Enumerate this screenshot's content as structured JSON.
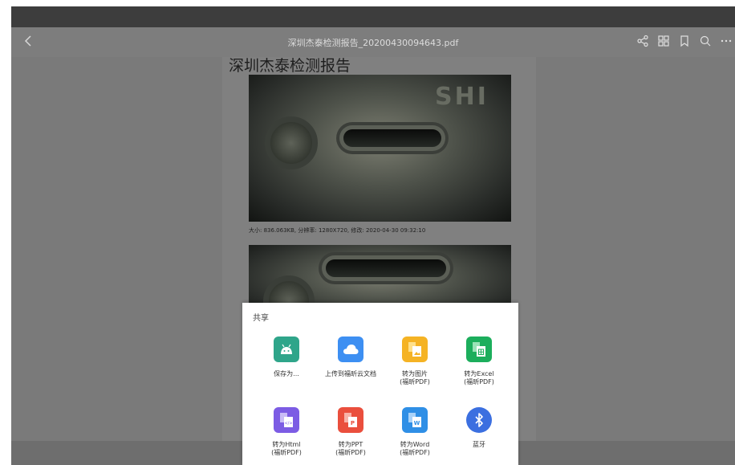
{
  "toolbar": {
    "document_title": "深圳杰泰检测报告_20200430094643.pdf"
  },
  "document": {
    "heading": "深圳杰泰检测报告",
    "photo_caption": "大小: 836.063KB, 分辨率: 1280X720, 修改: 2020-04-30 09:32:10",
    "embossed_text": "SHI"
  },
  "share": {
    "title": "共享",
    "items": [
      {
        "label": "保存为...",
        "icon": "android-save-icon",
        "color": "#2fa58a"
      },
      {
        "label": "上传到福昕云文档",
        "icon": "cloud-upload-icon",
        "color": "#3d8ff2"
      },
      {
        "label": "转为图片\n(福昕PDF)",
        "icon": "convert-image-icon",
        "color": "#f5b324"
      },
      {
        "label": "转为Excel\n(福昕PDF)",
        "icon": "convert-excel-icon",
        "color": "#1cae5c"
      },
      {
        "label": "转为Html\n(福昕PDF)",
        "icon": "convert-html-icon",
        "color": "#7c5ce4"
      },
      {
        "label": "转为PPT\n(福昕PDF)",
        "icon": "convert-ppt-icon",
        "color": "#ea4f3d"
      },
      {
        "label": "转为Word\n(福昕PDF)",
        "icon": "convert-word-icon",
        "color": "#2f8fe6"
      },
      {
        "label": "蓝牙",
        "icon": "bluetooth-icon",
        "color": "#3b6fe0"
      }
    ]
  }
}
